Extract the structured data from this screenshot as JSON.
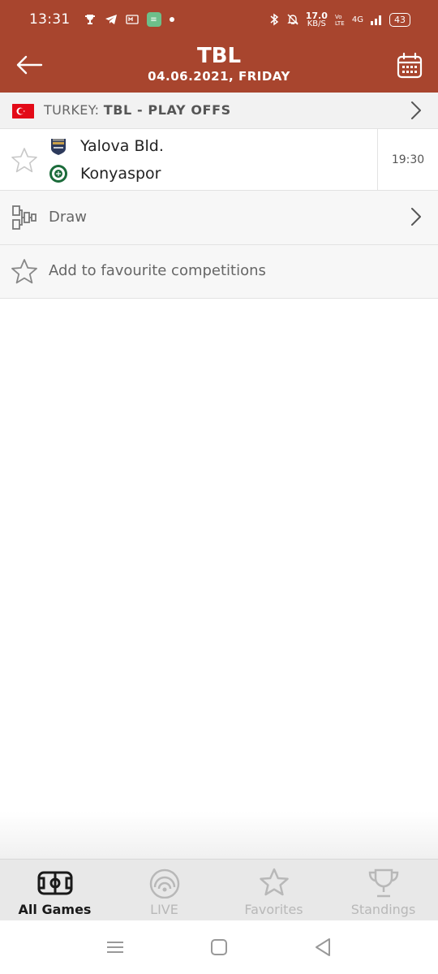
{
  "status_bar": {
    "time": "13:31",
    "speed_value": "17.0",
    "speed_unit": "KB/S",
    "network": "4G",
    "battery": "43"
  },
  "app_bar": {
    "title": "TBL",
    "subtitle": "04.06.2021, FRIDAY",
    "back_icon": "arrow-left-icon",
    "calendar_icon": "calendar-icon"
  },
  "competition": {
    "country": "TURKEY:",
    "name": "TBL - PLAY OFFS",
    "flag_color": "#e30a17"
  },
  "match": {
    "home_team": "Yalova Bld.",
    "away_team": "Konyaspor",
    "time": "19:30"
  },
  "rows": {
    "draw_label": "Draw",
    "favourite_label": "Add to favourite competitions"
  },
  "bottom_nav": {
    "items": [
      {
        "label": "All Games",
        "icon": "field-icon",
        "active": true
      },
      {
        "label": "LIVE",
        "icon": "live-icon",
        "active": false
      },
      {
        "label": "Favorites",
        "icon": "star-icon",
        "active": false
      },
      {
        "label": "Standings",
        "icon": "trophy-icon",
        "active": false
      }
    ]
  },
  "colors": {
    "brand": "#a8452e",
    "active_nav": "#1a1a1a",
    "inactive_nav": "#b8b8b8"
  }
}
